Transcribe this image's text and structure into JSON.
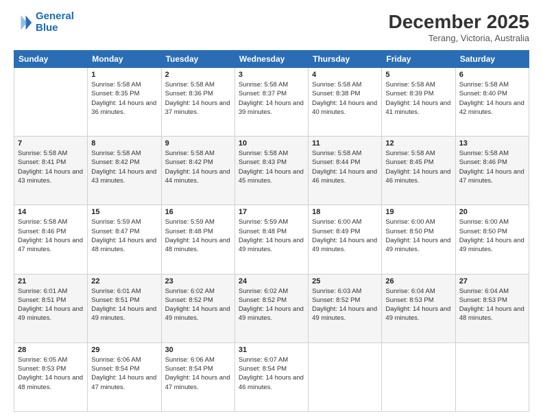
{
  "header": {
    "logo_line1": "General",
    "logo_line2": "Blue",
    "month": "December 2025",
    "location": "Terang, Victoria, Australia"
  },
  "days_of_week": [
    "Sunday",
    "Monday",
    "Tuesday",
    "Wednesday",
    "Thursday",
    "Friday",
    "Saturday"
  ],
  "weeks": [
    [
      {
        "day": "",
        "sunrise": "",
        "sunset": "",
        "daylight": ""
      },
      {
        "day": "1",
        "sunrise": "Sunrise: 5:58 AM",
        "sunset": "Sunset: 8:35 PM",
        "daylight": "Daylight: 14 hours and 36 minutes."
      },
      {
        "day": "2",
        "sunrise": "Sunrise: 5:58 AM",
        "sunset": "Sunset: 8:36 PM",
        "daylight": "Daylight: 14 hours and 37 minutes."
      },
      {
        "day": "3",
        "sunrise": "Sunrise: 5:58 AM",
        "sunset": "Sunset: 8:37 PM",
        "daylight": "Daylight: 14 hours and 39 minutes."
      },
      {
        "day": "4",
        "sunrise": "Sunrise: 5:58 AM",
        "sunset": "Sunset: 8:38 PM",
        "daylight": "Daylight: 14 hours and 40 minutes."
      },
      {
        "day": "5",
        "sunrise": "Sunrise: 5:58 AM",
        "sunset": "Sunset: 8:39 PM",
        "daylight": "Daylight: 14 hours and 41 minutes."
      },
      {
        "day": "6",
        "sunrise": "Sunrise: 5:58 AM",
        "sunset": "Sunset: 8:40 PM",
        "daylight": "Daylight: 14 hours and 42 minutes."
      }
    ],
    [
      {
        "day": "7",
        "sunrise": "Sunrise: 5:58 AM",
        "sunset": "Sunset: 8:41 PM",
        "daylight": "Daylight: 14 hours and 43 minutes."
      },
      {
        "day": "8",
        "sunrise": "Sunrise: 5:58 AM",
        "sunset": "Sunset: 8:42 PM",
        "daylight": "Daylight: 14 hours and 43 minutes."
      },
      {
        "day": "9",
        "sunrise": "Sunrise: 5:58 AM",
        "sunset": "Sunset: 8:42 PM",
        "daylight": "Daylight: 14 hours and 44 minutes."
      },
      {
        "day": "10",
        "sunrise": "Sunrise: 5:58 AM",
        "sunset": "Sunset: 8:43 PM",
        "daylight": "Daylight: 14 hours and 45 minutes."
      },
      {
        "day": "11",
        "sunrise": "Sunrise: 5:58 AM",
        "sunset": "Sunset: 8:44 PM",
        "daylight": "Daylight: 14 hours and 46 minutes."
      },
      {
        "day": "12",
        "sunrise": "Sunrise: 5:58 AM",
        "sunset": "Sunset: 8:45 PM",
        "daylight": "Daylight: 14 hours and 46 minutes."
      },
      {
        "day": "13",
        "sunrise": "Sunrise: 5:58 AM",
        "sunset": "Sunset: 8:46 PM",
        "daylight": "Daylight: 14 hours and 47 minutes."
      }
    ],
    [
      {
        "day": "14",
        "sunrise": "Sunrise: 5:58 AM",
        "sunset": "Sunset: 8:46 PM",
        "daylight": "Daylight: 14 hours and 47 minutes."
      },
      {
        "day": "15",
        "sunrise": "Sunrise: 5:59 AM",
        "sunset": "Sunset: 8:47 PM",
        "daylight": "Daylight: 14 hours and 48 minutes."
      },
      {
        "day": "16",
        "sunrise": "Sunrise: 5:59 AM",
        "sunset": "Sunset: 8:48 PM",
        "daylight": "Daylight: 14 hours and 48 minutes."
      },
      {
        "day": "17",
        "sunrise": "Sunrise: 5:59 AM",
        "sunset": "Sunset: 8:48 PM",
        "daylight": "Daylight: 14 hours and 49 minutes."
      },
      {
        "day": "18",
        "sunrise": "Sunrise: 6:00 AM",
        "sunset": "Sunset: 8:49 PM",
        "daylight": "Daylight: 14 hours and 49 minutes."
      },
      {
        "day": "19",
        "sunrise": "Sunrise: 6:00 AM",
        "sunset": "Sunset: 8:50 PM",
        "daylight": "Daylight: 14 hours and 49 minutes."
      },
      {
        "day": "20",
        "sunrise": "Sunrise: 6:00 AM",
        "sunset": "Sunset: 8:50 PM",
        "daylight": "Daylight: 14 hours and 49 minutes."
      }
    ],
    [
      {
        "day": "21",
        "sunrise": "Sunrise: 6:01 AM",
        "sunset": "Sunset: 8:51 PM",
        "daylight": "Daylight: 14 hours and 49 minutes."
      },
      {
        "day": "22",
        "sunrise": "Sunrise: 6:01 AM",
        "sunset": "Sunset: 8:51 PM",
        "daylight": "Daylight: 14 hours and 49 minutes."
      },
      {
        "day": "23",
        "sunrise": "Sunrise: 6:02 AM",
        "sunset": "Sunset: 8:52 PM",
        "daylight": "Daylight: 14 hours and 49 minutes."
      },
      {
        "day": "24",
        "sunrise": "Sunrise: 6:02 AM",
        "sunset": "Sunset: 8:52 PM",
        "daylight": "Daylight: 14 hours and 49 minutes."
      },
      {
        "day": "25",
        "sunrise": "Sunrise: 6:03 AM",
        "sunset": "Sunset: 8:52 PM",
        "daylight": "Daylight: 14 hours and 49 minutes."
      },
      {
        "day": "26",
        "sunrise": "Sunrise: 6:04 AM",
        "sunset": "Sunset: 8:53 PM",
        "daylight": "Daylight: 14 hours and 49 minutes."
      },
      {
        "day": "27",
        "sunrise": "Sunrise: 6:04 AM",
        "sunset": "Sunset: 8:53 PM",
        "daylight": "Daylight: 14 hours and 48 minutes."
      }
    ],
    [
      {
        "day": "28",
        "sunrise": "Sunrise: 6:05 AM",
        "sunset": "Sunset: 8:53 PM",
        "daylight": "Daylight: 14 hours and 48 minutes."
      },
      {
        "day": "29",
        "sunrise": "Sunrise: 6:06 AM",
        "sunset": "Sunset: 8:54 PM",
        "daylight": "Daylight: 14 hours and 47 minutes."
      },
      {
        "day": "30",
        "sunrise": "Sunrise: 6:06 AM",
        "sunset": "Sunset: 8:54 PM",
        "daylight": "Daylight: 14 hours and 47 minutes."
      },
      {
        "day": "31",
        "sunrise": "Sunrise: 6:07 AM",
        "sunset": "Sunset: 8:54 PM",
        "daylight": "Daylight: 14 hours and 46 minutes."
      },
      {
        "day": "",
        "sunrise": "",
        "sunset": "",
        "daylight": ""
      },
      {
        "day": "",
        "sunrise": "",
        "sunset": "",
        "daylight": ""
      },
      {
        "day": "",
        "sunrise": "",
        "sunset": "",
        "daylight": ""
      }
    ]
  ]
}
